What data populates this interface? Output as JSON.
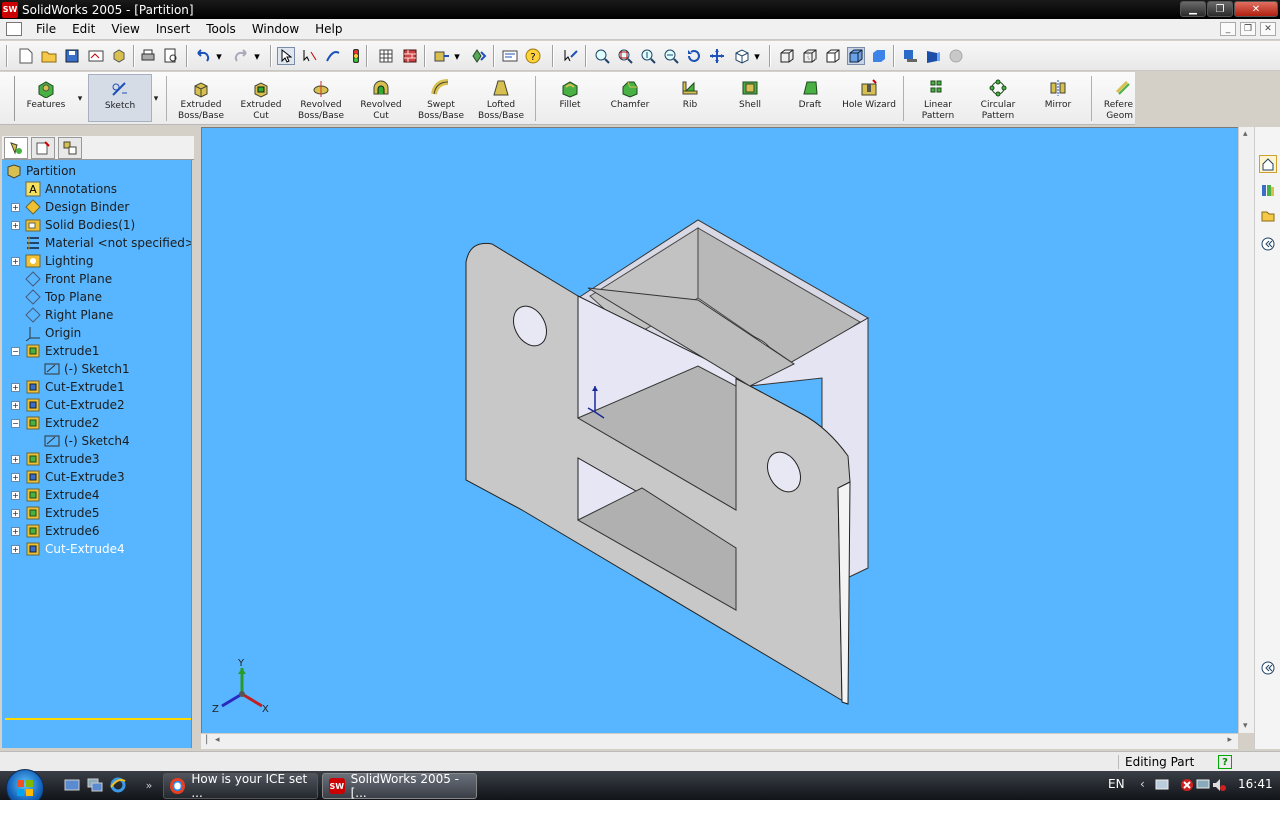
{
  "window": {
    "title": "SolidWorks 2005 - [Partition]",
    "app_badge": "SW"
  },
  "menu": [
    "File",
    "Edit",
    "View",
    "Insert",
    "Tools",
    "Window",
    "Help"
  ],
  "features_toolbar": {
    "features_label": "Features",
    "sketch_label": "Sketch",
    "commands": [
      {
        "l1": "Extruded",
        "l2": "Boss/Base"
      },
      {
        "l1": "Extruded Cut",
        "l2": ""
      },
      {
        "l1": "Revolved",
        "l2": "Boss/Base"
      },
      {
        "l1": "Revolved Cut",
        "l2": ""
      },
      {
        "l1": "Swept",
        "l2": "Boss/Base"
      },
      {
        "l1": "Lofted",
        "l2": "Boss/Base"
      },
      {
        "l1": "Fillet",
        "l2": ""
      },
      {
        "l1": "Chamfer",
        "l2": ""
      },
      {
        "l1": "Rib",
        "l2": ""
      },
      {
        "l1": "Shell",
        "l2": ""
      },
      {
        "l1": "Draft",
        "l2": ""
      },
      {
        "l1": "Hole Wizard",
        "l2": ""
      },
      {
        "l1": "Linear",
        "l2": "Pattern"
      },
      {
        "l1": "Circular",
        "l2": "Pattern"
      },
      {
        "l1": "Mirror",
        "l2": ""
      },
      {
        "l1": "Refere",
        "l2": "Geom"
      }
    ]
  },
  "tree": {
    "root": "Partition",
    "items": [
      "Annotations",
      "Design Binder",
      "Solid Bodies(1)",
      "Material <not specified>",
      "Lighting",
      "Front Plane",
      "Top Plane",
      "Right Plane",
      "Origin",
      "Extrude1",
      "(-) Sketch1",
      "Cut-Extrude1",
      "Cut-Extrude2",
      "Extrude2",
      "(-) Sketch4",
      "Extrude3",
      "Cut-Extrude3",
      "Extrude4",
      "Extrude5",
      "Extrude6",
      "Cut-Extrude4"
    ]
  },
  "triad": {
    "x": "X",
    "y": "Y",
    "z": "Z"
  },
  "status": {
    "text": "Editing Part"
  },
  "taskbar": {
    "buttons": [
      "How is your ICE set ...",
      "SolidWorks 2005 - [..."
    ],
    "language": "EN",
    "clock": "16:41"
  },
  "colors": {
    "viewport_bg": "#57b6ff",
    "part_face": "#c8c8c8",
    "part_light": "#e8e8f4",
    "part_dark": "#a8a8a8"
  }
}
